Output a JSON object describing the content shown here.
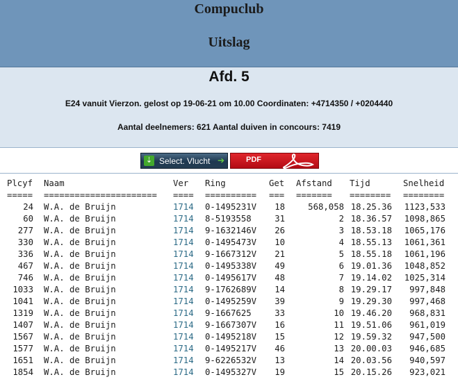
{
  "header": {
    "club": "Compuclub",
    "page_title": "Uitslag"
  },
  "info": {
    "afdeling": "Afd. 5",
    "flight_line": "E24 vanuit Vierzon. gelost op 19-06-21 om 10.00 Coordinaten: +4714350 / +0204440",
    "counts_line": "Aantal deelnemers: 621 Aantal duiven in concours: 7419"
  },
  "buttons": {
    "select_label": "Select. Vlucht",
    "pdf_label": "PDF"
  },
  "table": {
    "headers": {
      "plcyf": "Plcyf",
      "naam": "Naam",
      "ver": "Ver",
      "ring": "Ring",
      "get": "Get",
      "afstand": "Afstand",
      "tijd": "Tijd",
      "snelheid": "Snelheid"
    },
    "separators": {
      "plcyf": "=====",
      "naam": "======================",
      "ver": "====",
      "ring": "==========",
      "get": "===",
      "afstand": "=======",
      "tijd": "========",
      "snelheid": "========"
    },
    "rows": [
      {
        "plcyf": "24",
        "naam": "W.A. de Bruijn",
        "ver": "1714",
        "ring": "0-1495231V",
        "get": "18",
        "afstand": "568,058",
        "tijd": "18.25.36",
        "snelheid": "1123,533"
      },
      {
        "plcyf": "60",
        "naam": "W.A. de Bruijn",
        "ver": "1714",
        "ring": "8-5193558",
        "get": "31",
        "afstand": "2",
        "tijd": "18.36.57",
        "snelheid": "1098,865"
      },
      {
        "plcyf": "277",
        "naam": "W.A. de Bruijn",
        "ver": "1714",
        "ring": "9-1632146V",
        "get": "26",
        "afstand": "3",
        "tijd": "18.53.18",
        "snelheid": "1065,176"
      },
      {
        "plcyf": "330",
        "naam": "W.A. de Bruijn",
        "ver": "1714",
        "ring": "0-1495473V",
        "get": "10",
        "afstand": "4",
        "tijd": "18.55.13",
        "snelheid": "1061,361"
      },
      {
        "plcyf": "336",
        "naam": "W.A. de Bruijn",
        "ver": "1714",
        "ring": "9-1667312V",
        "get": "21",
        "afstand": "5",
        "tijd": "18.55.18",
        "snelheid": "1061,196"
      },
      {
        "plcyf": "467",
        "naam": "W.A. de Bruijn",
        "ver": "1714",
        "ring": "0-1495338V",
        "get": "49",
        "afstand": "6",
        "tijd": "19.01.36",
        "snelheid": "1048,852"
      },
      {
        "plcyf": "746",
        "naam": "W.A. de Bruijn",
        "ver": "1714",
        "ring": "0-1495617V",
        "get": "48",
        "afstand": "7",
        "tijd": "19.14.02",
        "snelheid": "1025,314"
      },
      {
        "plcyf": "1033",
        "naam": "W.A. de Bruijn",
        "ver": "1714",
        "ring": "9-1762689V",
        "get": "14",
        "afstand": "8",
        "tijd": "19.29.17",
        "snelheid": "997,848"
      },
      {
        "plcyf": "1041",
        "naam": "W.A. de Bruijn",
        "ver": "1714",
        "ring": "0-1495259V",
        "get": "39",
        "afstand": "9",
        "tijd": "19.29.30",
        "snelheid": "997,468"
      },
      {
        "plcyf": "1319",
        "naam": "W.A. de Bruijn",
        "ver": "1714",
        "ring": "9-1667625",
        "get": "33",
        "afstand": "10",
        "tijd": "19.46.20",
        "snelheid": "968,831"
      },
      {
        "plcyf": "1407",
        "naam": "W.A. de Bruijn",
        "ver": "1714",
        "ring": "9-1667307V",
        "get": "16",
        "afstand": "11",
        "tijd": "19.51.06",
        "snelheid": "961,019"
      },
      {
        "plcyf": "1567",
        "naam": "W.A. de Bruijn",
        "ver": "1714",
        "ring": "0-1495218V",
        "get": "15",
        "afstand": "12",
        "tijd": "19.59.32",
        "snelheid": "947,500"
      },
      {
        "plcyf": "1577",
        "naam": "W.A. de Bruijn",
        "ver": "1714",
        "ring": "0-1495217V",
        "get": "46",
        "afstand": "13",
        "tijd": "20.00.03",
        "snelheid": "946,685"
      },
      {
        "plcyf": "1651",
        "naam": "W.A. de Bruijn",
        "ver": "1714",
        "ring": "9-6226532V",
        "get": "13",
        "afstand": "14",
        "tijd": "20.03.56",
        "snelheid": "940,597"
      },
      {
        "plcyf": "1854",
        "naam": "W.A. de Bruijn",
        "ver": "1714",
        "ring": "0-1495327V",
        "get": "19",
        "afstand": "15",
        "tijd": "20.15.26",
        "snelheid": "923,021"
      }
    ]
  }
}
